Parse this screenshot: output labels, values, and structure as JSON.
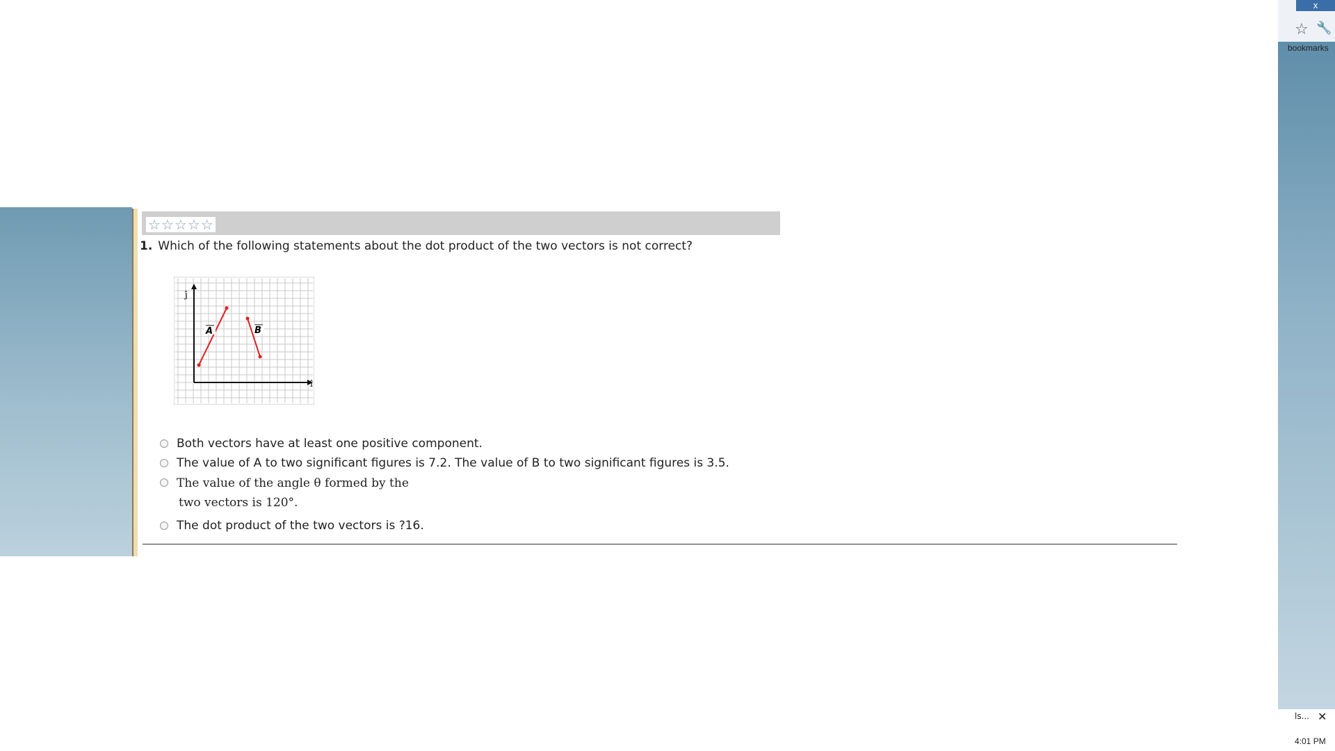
{
  "browser": {
    "close_label": "x",
    "bookmarks_label": "bookmarks"
  },
  "question": {
    "rating_stars": [
      "☆",
      "☆",
      "☆",
      "☆",
      "☆"
    ],
    "number": "1.",
    "text": "Which of the following statements about the dot product of the two vectors is not correct?"
  },
  "figure": {
    "vector_a_label": "A",
    "vector_b_label": "B",
    "x_axis_label": "î",
    "y_axis_label": "ĵ"
  },
  "choices": [
    {
      "text": "Both vectors have at least one positive component."
    },
    {
      "text": "The value of A to two significant figures is 7.2. The value of B to two significant figures is 3.5."
    },
    {
      "text_line1": "The value of the angle θ formed by the",
      "text_line2": "two vectors is 120°."
    },
    {
      "text": "The dot product of the two vectors is ?16."
    }
  ],
  "taskbar": {
    "tab_label": "ls...",
    "close_label": "✕",
    "time": "4:01 PM"
  },
  "colors": {
    "vector": "#e02020",
    "grid": "#c9c9c9",
    "bar": "#cfcfcf"
  }
}
